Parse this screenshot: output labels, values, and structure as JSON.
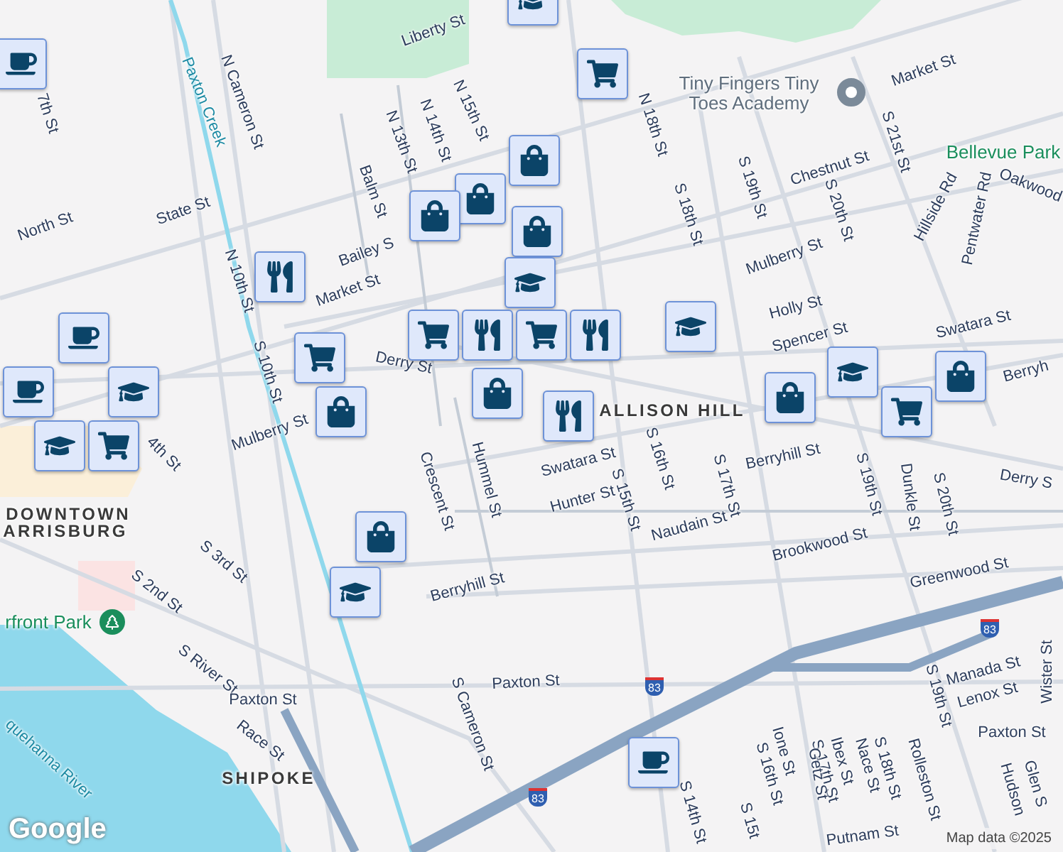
{
  "map": {
    "labels": [
      {
        "kind": "street",
        "text": "Liberty St"
      },
      {
        "kind": "water",
        "text": "Paxton Creek"
      },
      {
        "kind": "street",
        "text": "N Cameron St"
      },
      {
        "kind": "street",
        "text": "7th St"
      },
      {
        "kind": "street",
        "text": "N 13th St"
      },
      {
        "kind": "street",
        "text": "N 14th St"
      },
      {
        "kind": "street",
        "text": "N 15th St"
      },
      {
        "kind": "street",
        "text": "Balm St"
      },
      {
        "kind": "street",
        "text": "State St"
      },
      {
        "kind": "street",
        "text": "North St"
      },
      {
        "kind": "street",
        "text": "Bailey S"
      },
      {
        "kind": "street",
        "text": "N 10th St"
      },
      {
        "kind": "street",
        "text": "Market St"
      },
      {
        "kind": "street",
        "text": "S 10th St"
      },
      {
        "kind": "street",
        "text": "Derry St"
      },
      {
        "kind": "poi",
        "text": "Tiny Fingers Tiny\nToes Academy"
      },
      {
        "kind": "street",
        "text": "Market St"
      },
      {
        "kind": "street",
        "text": "N 18th St"
      },
      {
        "kind": "street",
        "text": "S 21st St"
      },
      {
        "kind": "park",
        "text": "Bellevue Park"
      },
      {
        "kind": "street",
        "text": "Oakwood"
      },
      {
        "kind": "street",
        "text": "Chestnut St"
      },
      {
        "kind": "street",
        "text": "S 19th St"
      },
      {
        "kind": "street",
        "text": "S 20th St"
      },
      {
        "kind": "street",
        "text": "Hillside Rd"
      },
      {
        "kind": "street",
        "text": "Pentwater Rd"
      },
      {
        "kind": "street",
        "text": "S 18th St"
      },
      {
        "kind": "street",
        "text": "Mulberry St"
      },
      {
        "kind": "street",
        "text": "Holly St"
      },
      {
        "kind": "street",
        "text": "Spencer St"
      },
      {
        "kind": "street",
        "text": "Swatara St"
      },
      {
        "kind": "street",
        "text": "Berryh"
      },
      {
        "kind": "area",
        "text": "ALLISON HILL"
      },
      {
        "kind": "street",
        "text": "Derry S"
      },
      {
        "kind": "street",
        "text": "Mulberry St"
      },
      {
        "kind": "street",
        "text": "4th St"
      },
      {
        "kind": "area",
        "text": "DOWNTOWN"
      },
      {
        "kind": "area",
        "text": "ARRISBURG"
      },
      {
        "kind": "street",
        "text": "Crescent St"
      },
      {
        "kind": "street",
        "text": "Hummel St"
      },
      {
        "kind": "street",
        "text": "Swatara St"
      },
      {
        "kind": "street",
        "text": "Hunter St"
      },
      {
        "kind": "street",
        "text": "S 15th St"
      },
      {
        "kind": "street",
        "text": "S 16th St"
      },
      {
        "kind": "street",
        "text": "S 17th St"
      },
      {
        "kind": "street",
        "text": "Berryhill St"
      },
      {
        "kind": "street",
        "text": "S 19th St"
      },
      {
        "kind": "street",
        "text": "Dunkle St"
      },
      {
        "kind": "street",
        "text": "S 20th St"
      },
      {
        "kind": "street",
        "text": "Naudain St"
      },
      {
        "kind": "street",
        "text": "Brookwood St"
      },
      {
        "kind": "street",
        "text": "Greenwood St"
      },
      {
        "kind": "street",
        "text": "S 3rd St"
      },
      {
        "kind": "street",
        "text": "S 2nd St"
      },
      {
        "kind": "park",
        "text": "rfront Park"
      },
      {
        "kind": "street",
        "text": "Berryhill St"
      },
      {
        "kind": "street",
        "text": "S River St"
      },
      {
        "kind": "street",
        "text": "Paxton St"
      },
      {
        "kind": "street",
        "text": "Paxton St"
      },
      {
        "kind": "street",
        "text": "Race St"
      },
      {
        "kind": "water",
        "text": "quehanna River"
      },
      {
        "kind": "area",
        "text": "SHIPOKE"
      },
      {
        "kind": "street",
        "text": "S Cameron St"
      },
      {
        "kind": "street",
        "text": "Manada St"
      },
      {
        "kind": "street",
        "text": "Lenox St"
      },
      {
        "kind": "street",
        "text": "Wister St"
      },
      {
        "kind": "street",
        "text": "S 19th St"
      },
      {
        "kind": "street",
        "text": "Paxton St"
      },
      {
        "kind": "street",
        "text": "S 16th St"
      },
      {
        "kind": "street",
        "text": "Ione St"
      },
      {
        "kind": "street",
        "text": "S 17th St"
      },
      {
        "kind": "street",
        "text": "Getz St"
      },
      {
        "kind": "street",
        "text": "Ibex St"
      },
      {
        "kind": "street",
        "text": "Nace St"
      },
      {
        "kind": "street",
        "text": "S 18th St"
      },
      {
        "kind": "street",
        "text": "Rolleston St"
      },
      {
        "kind": "street",
        "text": "Hudson"
      },
      {
        "kind": "street",
        "text": "Glen S"
      },
      {
        "kind": "street",
        "text": "S 14th St"
      },
      {
        "kind": "street",
        "text": "S 15t"
      },
      {
        "kind": "street",
        "text": "Putnam St"
      }
    ],
    "shields": [
      "83",
      "83",
      "83"
    ],
    "markers": [
      {
        "kind": "cafe"
      },
      {
        "kind": "school"
      },
      {
        "kind": "grocery"
      },
      {
        "kind": "shop"
      },
      {
        "kind": "shop"
      },
      {
        "kind": "shop"
      },
      {
        "kind": "shop"
      },
      {
        "kind": "restaurant"
      },
      {
        "kind": "school"
      },
      {
        "kind": "grocery"
      },
      {
        "kind": "restaurant"
      },
      {
        "kind": "grocery"
      },
      {
        "kind": "restaurant"
      },
      {
        "kind": "grocery"
      },
      {
        "kind": "shop"
      },
      {
        "kind": "cafe"
      },
      {
        "kind": "cafe"
      },
      {
        "kind": "school"
      },
      {
        "kind": "grocery"
      },
      {
        "kind": "school"
      },
      {
        "kind": "shop"
      },
      {
        "kind": "restaurant"
      },
      {
        "kind": "school"
      },
      {
        "kind": "shop"
      },
      {
        "kind": "grocery"
      },
      {
        "kind": "school"
      },
      {
        "kind": "shop"
      },
      {
        "kind": "shop"
      },
      {
        "kind": "school"
      },
      {
        "kind": "cafe"
      }
    ],
    "attribution": "Map data ©2025",
    "logo": "Google"
  }
}
